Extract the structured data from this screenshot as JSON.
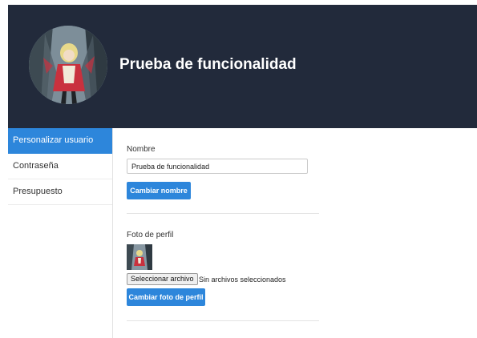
{
  "header": {
    "title": "Prueba de funcionalidad",
    "background_color": "#222a3b",
    "avatar_icon": "user-avatar-artwork"
  },
  "sidebar": {
    "items": [
      {
        "label": "Personalizar usuario",
        "active": true
      },
      {
        "label": "Contraseña",
        "active": false
      },
      {
        "label": "Presupuesto",
        "active": false
      }
    ],
    "active_color": "#2d86db"
  },
  "main": {
    "name_section": {
      "label": "Nombre",
      "input_value": "Prueba de funcionalidad",
      "button_label": "Cambiar nombre"
    },
    "photo_section": {
      "label": "Foto de perfil",
      "file_button_label": "Seleccionar archivo",
      "file_status": "Sin archivos seleccionados",
      "button_label": "Cambiar foto de perfil"
    }
  },
  "accent_color": "#2d86db"
}
